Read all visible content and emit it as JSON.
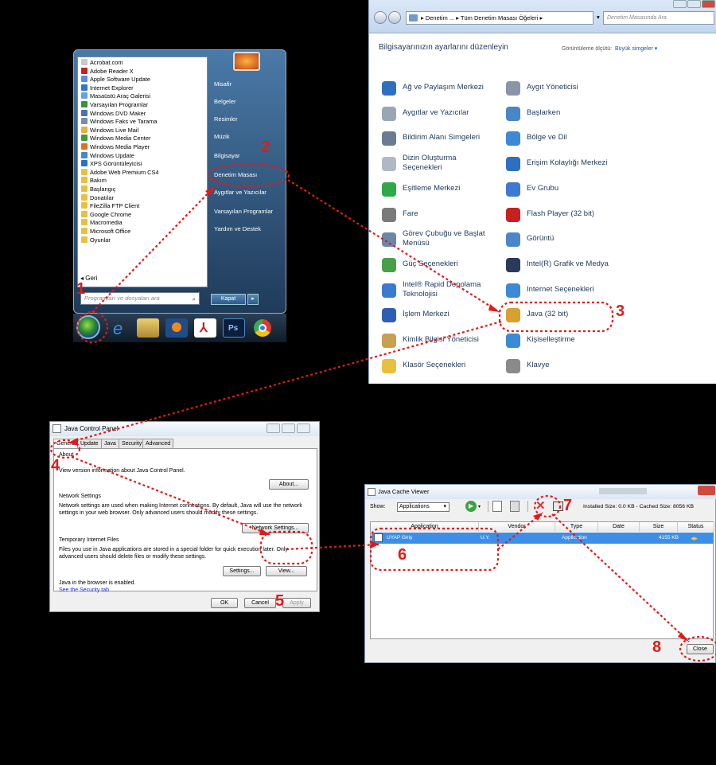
{
  "start_menu": {
    "programs": [
      {
        "label": "Acrobat.com",
        "color": "#c9c9c9"
      },
      {
        "label": "Adobe Reader X",
        "color": "#c8201f"
      },
      {
        "label": "Apple Software Update",
        "color": "#5a8fd6"
      },
      {
        "label": "Internet Explorer",
        "color": "#2f78c8"
      },
      {
        "label": "Masaüstü Araç Galerisi",
        "color": "#6aa0d8"
      },
      {
        "label": "Varsayılan Programlar",
        "color": "#3f8f3f"
      },
      {
        "label": "Windows DVD Maker",
        "color": "#4f6fb3"
      },
      {
        "label": "Windows Faks ve Tarama",
        "color": "#7a8ca8"
      },
      {
        "label": "Windows Live Mail",
        "color": "#e0b040"
      },
      {
        "label": "Windows Media Center",
        "color": "#3c9c3c"
      },
      {
        "label": "Windows Media Player",
        "color": "#e07020"
      },
      {
        "label": "Windows Update",
        "color": "#4a86c8"
      },
      {
        "label": "XPS Görüntüleyicisi",
        "color": "#2f6fbf"
      },
      {
        "label": "Adobe Web Premium CS4",
        "color": "#e8c040"
      },
      {
        "label": "Bakım",
        "color": "#e8c040"
      },
      {
        "label": "Başlangıç",
        "color": "#e8c040"
      },
      {
        "label": "Donatılar",
        "color": "#e8c040"
      },
      {
        "label": "FileZilla FTP Client",
        "color": "#e8c040"
      },
      {
        "label": "Google Chrome",
        "color": "#e8c040"
      },
      {
        "label": "Macromedia",
        "color": "#e8c040"
      },
      {
        "label": "Microsoft Office",
        "color": "#e8c040"
      },
      {
        "label": "Oyunlar",
        "color": "#e8c040"
      }
    ],
    "back_label": "Geri",
    "search_placeholder": "Programları ve dosyaları ara",
    "right_items": [
      "Misafir",
      "Belgeler",
      "Resimler",
      "Müzik",
      "Bilgisayar",
      "Denetim Masası",
      "Aygıtlar ve Yazıcılar",
      "Varsayılan Programlar",
      "Yardım ve Destek"
    ],
    "shutdown_label": "Kapat"
  },
  "control_panel": {
    "address": "▸ Denetim ... ▸ Tüm Denetim Masası Öğeleri ▸",
    "refresh": "▾",
    "search_placeholder": "Denetim Masasında Ara",
    "heading": "Bilgisayarınızın ayarlarını düzenleyin",
    "view_label": "Görüntüleme ölçütü:",
    "view_value": "Büyük simgeler ▾",
    "items": [
      {
        "label": "Ağ ve Paylaşım Merkezi",
        "color": "#2f6fbf"
      },
      {
        "label": "Aygıt Yöneticisi",
        "color": "#8a96a8"
      },
      {
        "label": "Aygıtlar ve Yazıcılar",
        "color": "#9aa6b6"
      },
      {
        "label": "Başlarken",
        "color": "#4a86c8"
      },
      {
        "label": "Bildirim Alanı Simgeleri",
        "color": "#6b7b90"
      },
      {
        "label": "Bölge ve Dil",
        "color": "#3c8ad6"
      },
      {
        "label": "Dizin Oluşturma\nSeçenekleri",
        "color": "#b0b8c4"
      },
      {
        "label": "Erişim Kolaylığı Merkezi",
        "color": "#2f6fbf"
      },
      {
        "label": "Eşitleme Merkezi",
        "color": "#2fa84a"
      },
      {
        "label": "Ev Grubu",
        "color": "#3c7ad0"
      },
      {
        "label": "Fare",
        "color": "#7a7a7a"
      },
      {
        "label": "Flash Player (32 bit)",
        "color": "#c8201f"
      },
      {
        "label": "Görev Çubuğu ve Başlat\nMenüsü",
        "color": "#6a86a8"
      },
      {
        "label": "Görüntü",
        "color": "#4a86c8"
      },
      {
        "label": "Güç Seçenekleri",
        "color": "#4aa04a"
      },
      {
        "label": "Intel(R) Grafik ve Medya",
        "color": "#2a3a5a"
      },
      {
        "label": "Intel® Rapid Depolama\nTeknolojisi",
        "color": "#3c7ad0"
      },
      {
        "label": "Internet Seçenekleri",
        "color": "#3c8ad6"
      },
      {
        "label": "İşlem Merkezi",
        "color": "#2f5fb0"
      },
      {
        "label": "Java (32 bit)",
        "color": "#d8a030"
      },
      {
        "label": "Kimlik Bilgisi Yöneticisi",
        "color": "#c8a050"
      },
      {
        "label": "Kişiselleştirme",
        "color": "#3c8ad6"
      },
      {
        "label": "Klasör Seçenekleri",
        "color": "#e8c040"
      },
      {
        "label": "Klavye",
        "color": "#8a8a8a"
      }
    ]
  },
  "java_control_panel": {
    "title": "Java Control Panel",
    "tabs": [
      "General",
      "Update",
      "Java",
      "Security",
      "Advanced"
    ],
    "about_heading": "About",
    "about_text": "View version information about Java Control Panel.",
    "about_button": "About...",
    "network_heading": "Network Settings",
    "network_text_1": "Network settings are used when making Internet connections. By default, Java will use the network",
    "network_text_2": "settings in your web browser. Only advanced users should modify these settings.",
    "network_button": "Network Settings...",
    "temp_heading": "Temporary Internet Files",
    "temp_text_1": "Files you use in Java applications are stored in a special folder for quick execution later. Only",
    "temp_text_2": "advanced users should delete files or modify these settings.",
    "settings_button": "Settings...",
    "view_button": "View...",
    "browser_text": "Java in the browser is enabled.",
    "security_link": "See the Security tab",
    "ok_button": "OK",
    "cancel_button": "Cancel",
    "apply_button": "Apply"
  },
  "cache_viewer": {
    "title": "Java Cache Viewer",
    "show_label": "Show:",
    "show_value": "Applications",
    "installed_size": "Installed Size: 0.0 KB - Cached Size: 8056 KB",
    "columns": [
      "Application",
      "Vendor",
      "Type",
      "Date",
      "Size",
      "Status"
    ],
    "row": {
      "application": "UYAP Giriş",
      "vendor": "U.Y.",
      "type": "Application",
      "date": "",
      "size": "4155 KB"
    },
    "close_button": "Close"
  },
  "steps": [
    "1",
    "2",
    "3",
    "4",
    "5",
    "6",
    "7",
    "8"
  ],
  "colors": {
    "annotation": "#e01a1a",
    "selection": "#3d8ee6",
    "taskbar": "#0f1c28"
  }
}
